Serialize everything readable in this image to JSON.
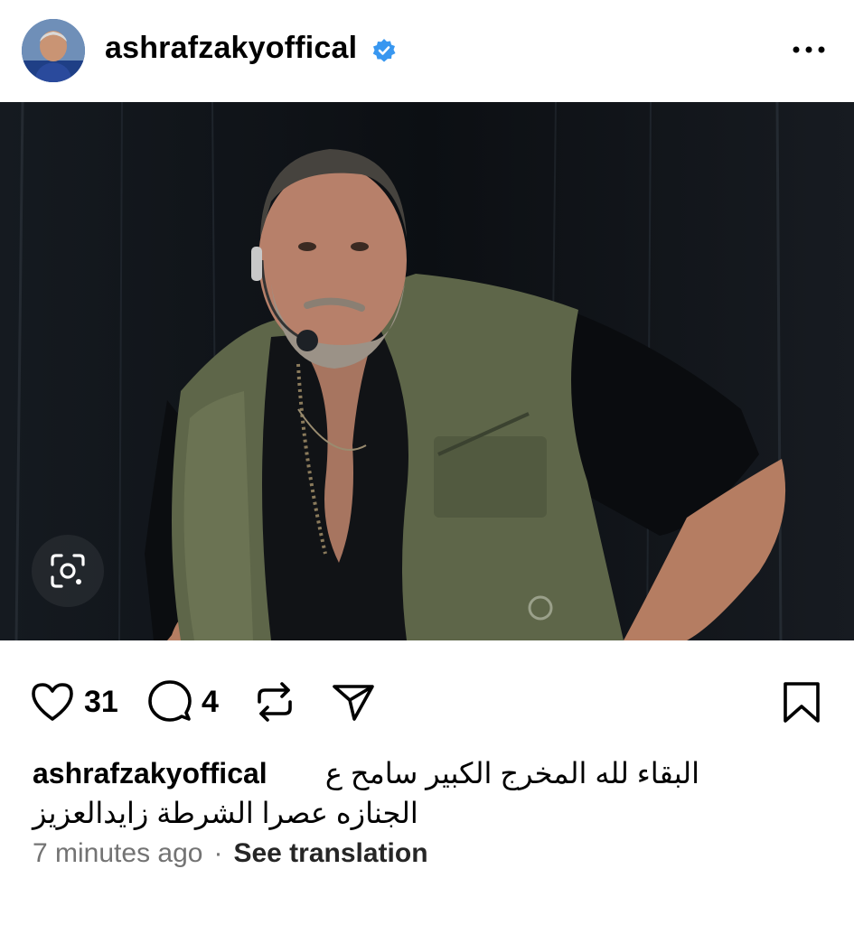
{
  "post": {
    "username": "ashrafzakyoffical",
    "verified": true,
    "more_icon": "more-horizontal-icon"
  },
  "actions": {
    "like_icon": "heart-icon",
    "like_count": "31",
    "comment_icon": "comment-icon",
    "comment_count": "4",
    "repost_icon": "repost-icon",
    "share_icon": "send-icon",
    "save_icon": "bookmark-icon"
  },
  "caption": {
    "username": "ashrafzakyoffical",
    "line1": "البقاء لله المخرج الكبير سامح ع",
    "line2": "الجنازه عصرا الشرطة زايدالعزيز"
  },
  "meta": {
    "time": "7 minutes ago",
    "separator": "·",
    "see_translation": "See translation"
  },
  "colors": {
    "verified_blue": "#3897f0",
    "text_primary": "#000000",
    "text_secondary": "#737373"
  }
}
